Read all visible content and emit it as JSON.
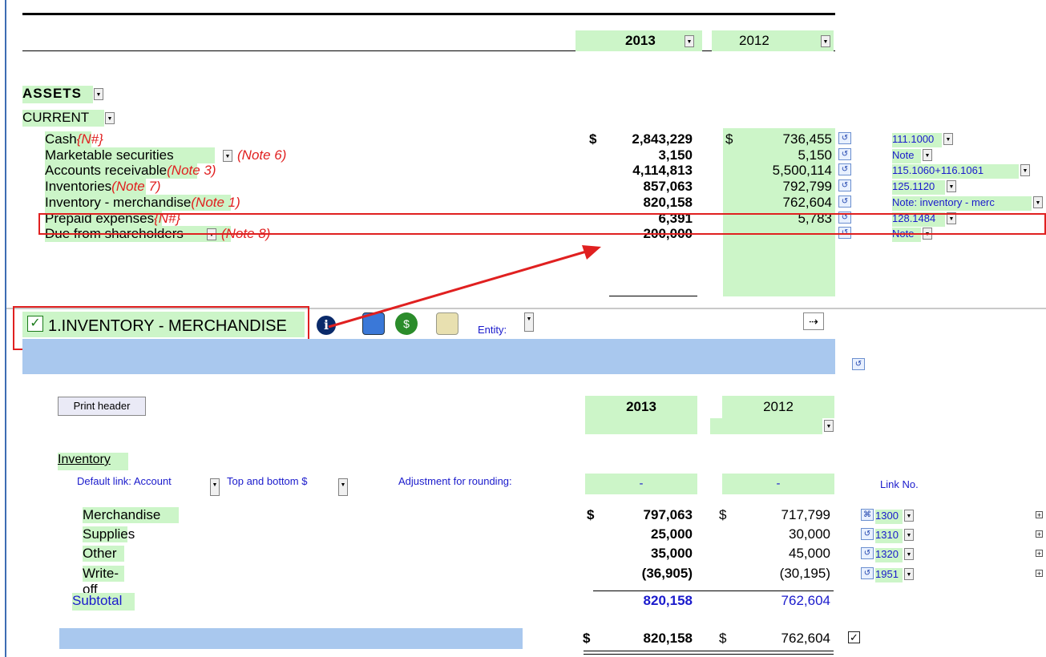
{
  "header": {
    "year1": "2013",
    "year2": "2012"
  },
  "assets": {
    "title": "ASSETS",
    "current_label": "CURRENT",
    "currency": "$",
    "rows": [
      {
        "label": "Cash",
        "note": "{N#}",
        "v2013": "2,843,229",
        "v2012": "736,455",
        "link": "111.1000"
      },
      {
        "label": "Marketable securities",
        "note": "(Note 6)",
        "v2013": "3,150",
        "v2012": "5,150",
        "link": "Note"
      },
      {
        "label": "Accounts receivable",
        "note": "(Note 3)",
        "v2013": "4,114,813",
        "v2012": "5,500,114",
        "link": "115.1060+116.1061"
      },
      {
        "label": "Inventories",
        "note": "(Note 7)",
        "v2013": "857,063",
        "v2012": "792,799",
        "link": "125.1120"
      },
      {
        "label": "Inventory - merchandise",
        "note": "(Note 1)",
        "v2013": "820,158",
        "v2012": "762,604",
        "link": "Note: inventory - merc"
      },
      {
        "label": "Prepaid expenses",
        "note": "{N#}",
        "v2013": "6,391",
        "v2012": "5,783",
        "link": "128.1484"
      },
      {
        "label": "Due from shareholders",
        "note": "(Note 8)",
        "v2013": "200,000",
        "v2012": "-",
        "link": "Note"
      }
    ]
  },
  "note_section": {
    "title": "1.INVENTORY - MERCHANDISE",
    "entity_label": "Entity:",
    "print_header": "Print header",
    "year1": "2013",
    "year2": "2012",
    "inventory_heading": "Inventory",
    "default_link": "Default link: Account",
    "top_bottom": "Top and bottom $",
    "adjustment_label": "Adjustment for rounding:",
    "adj_2013": "-",
    "adj_2012": "-",
    "link_no_header": "Link No.",
    "currency": "$",
    "rows": [
      {
        "label": "Merchandise",
        "v2013": "797,063",
        "v2012": "717,799",
        "link": "1300"
      },
      {
        "label": "Supplies",
        "v2013": "25,000",
        "v2012": "30,000",
        "link": "1310"
      },
      {
        "label": "Other",
        "v2013": "35,000",
        "v2012": "45,000",
        "link": "1320"
      },
      {
        "label": "Write-off",
        "v2013": "(36,905)",
        "v2012": "(30,195)",
        "link": "1951"
      }
    ],
    "subtotal_label": "Subtotal",
    "subtotal_2013": "820,158",
    "subtotal_2012": "762,604",
    "total_2013": "820,158",
    "total_2012": "762,604"
  },
  "colors": {
    "highlight": "#e02020",
    "green": "#ccf5c8",
    "band": "#a9c8ee",
    "link": "#1a1acc"
  }
}
